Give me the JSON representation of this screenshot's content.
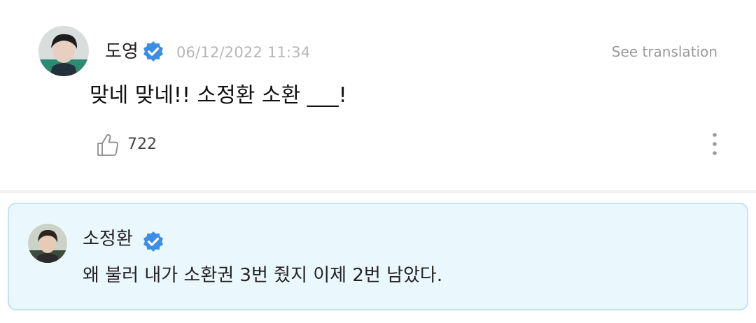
{
  "comment": {
    "author": "도영",
    "verified": true,
    "timestamp": "06/12/2022 11:34",
    "translate_label": "See translation",
    "text": "맞네 맞네!! 소정환 소환 ___!",
    "like_count": "722",
    "icons": {
      "avatar": "avatar",
      "verified": "verified-badge-icon",
      "like": "thumbs-up-icon",
      "more": "more-vertical-icon"
    }
  },
  "reply": {
    "author": "소정환",
    "verified": true,
    "text": "왜 불러 내가 소환권 3번 줬지 이제 2번 남았다."
  },
  "colors": {
    "verified_badge": "#3a8ee6",
    "reply_background": "#eaf7fd",
    "reply_border": "#bfe4f2",
    "timestamp": "#b6b6b6"
  }
}
